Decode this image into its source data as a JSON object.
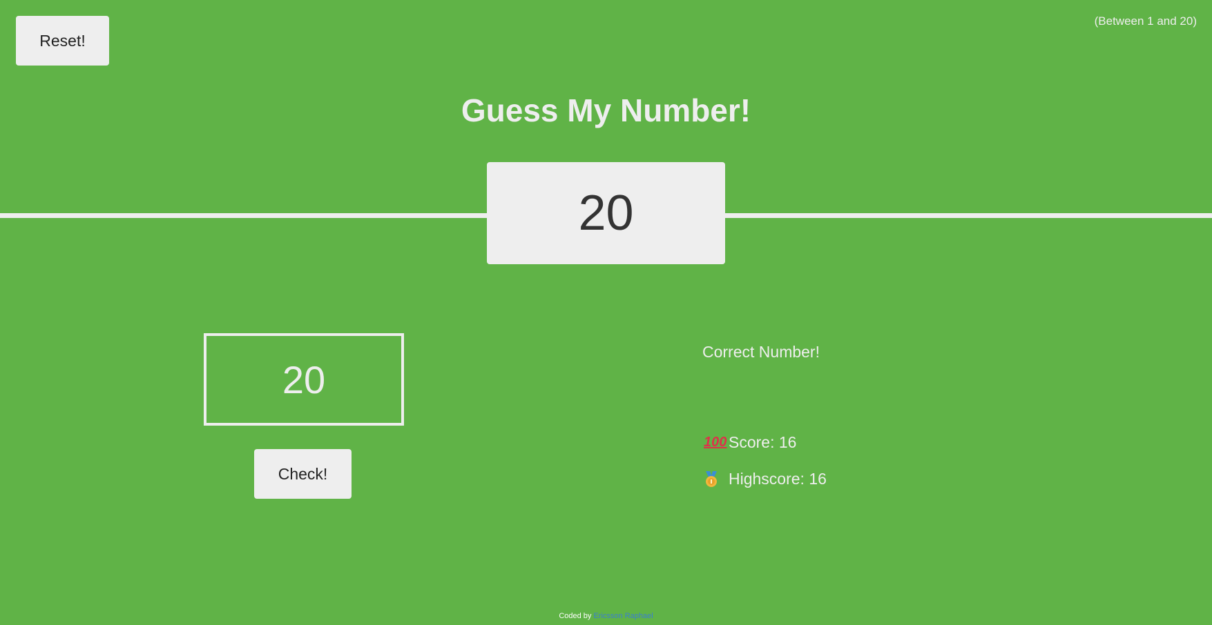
{
  "header": {
    "reset_label": "Reset!",
    "range_hint": "(Between 1 and 20)",
    "title": "Guess My Number!"
  },
  "secret": {
    "number": "20"
  },
  "guess": {
    "value": "20",
    "check_label": "Check!"
  },
  "status": {
    "message": "Correct Number!",
    "score_label": "Score: 16",
    "highscore_label": "Highscore: 16",
    "score_icon": "hundred-points-icon",
    "highscore_icon": "medal-icon"
  },
  "footer": {
    "prefix": "Coded by",
    "author": "Ericsson Raphael"
  },
  "colors": {
    "background": "#60b347",
    "foreground": "#eeeeee",
    "link": "#3b7fd0"
  }
}
